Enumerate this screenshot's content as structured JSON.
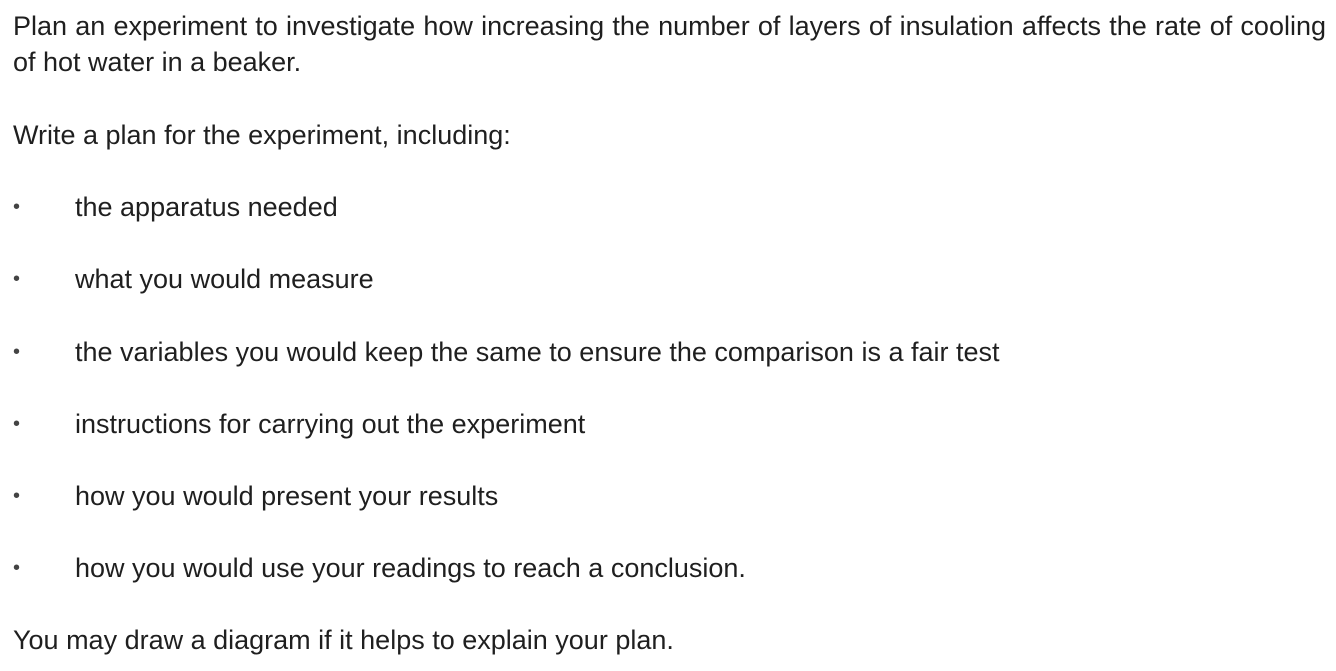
{
  "question": {
    "intro": "Plan an experiment to investigate how increasing the number of layers of insulation affects the rate of cooling of hot water in a beaker.",
    "instruction": "Write a plan for the experiment, including:",
    "bullet_symbol": "•",
    "bullets": [
      "the apparatus needed",
      "what you would measure",
      "the variables you would keep the same to ensure the comparison is a fair test",
      "instructions for carrying out the experiment",
      "how you would present your results",
      "how you would use your readings to reach a conclusion."
    ],
    "closing": "You may draw a diagram if it helps to explain your plan."
  }
}
